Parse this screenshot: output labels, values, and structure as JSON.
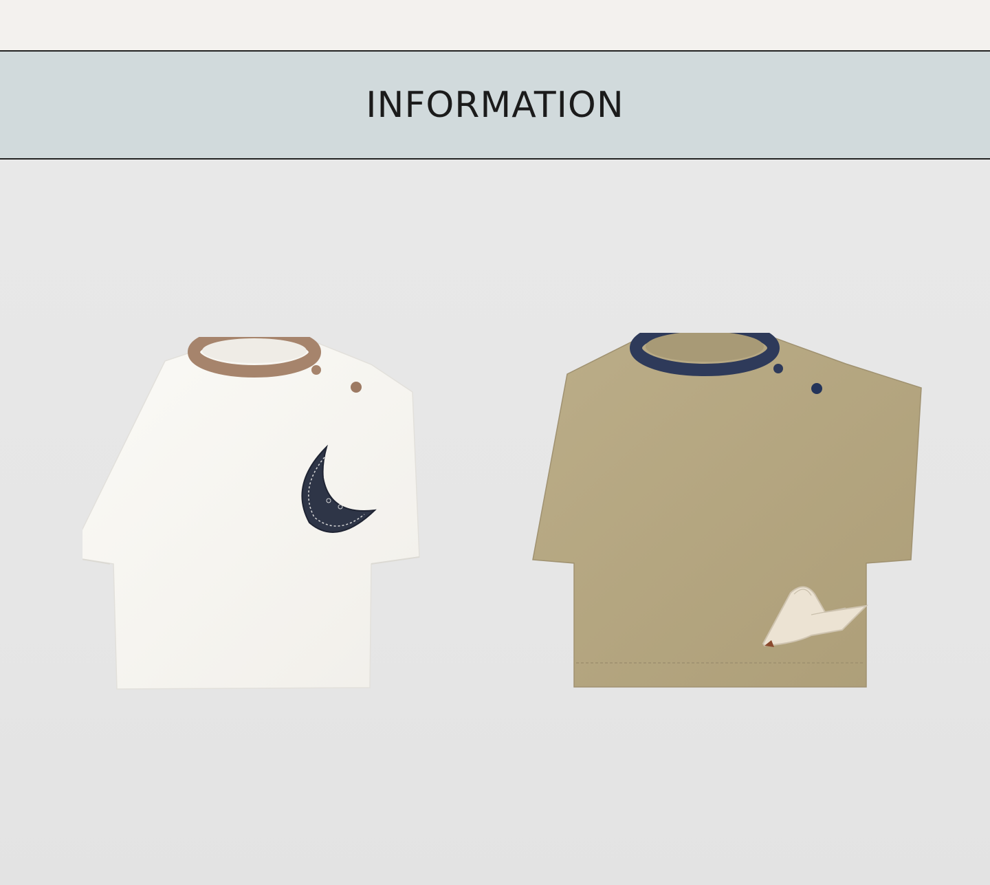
{
  "header": {
    "title": "INFORMATION"
  },
  "products": [
    {
      "name": "white-moon-tee",
      "body_color": "#f7f6f2",
      "collar_color": "#a6846c",
      "patch": "moon-icon",
      "patch_color": "#2e3547"
    },
    {
      "name": "khaki-bird-tee",
      "body_color": "#b6a882",
      "collar_color": "#2e3a5a",
      "patch": "bird-icon",
      "patch_color": "#ece3d3"
    }
  ],
  "colors": {
    "band": "#d1dadc",
    "background": "#e9e9e9",
    "top_strip": "#f3f1ee"
  }
}
